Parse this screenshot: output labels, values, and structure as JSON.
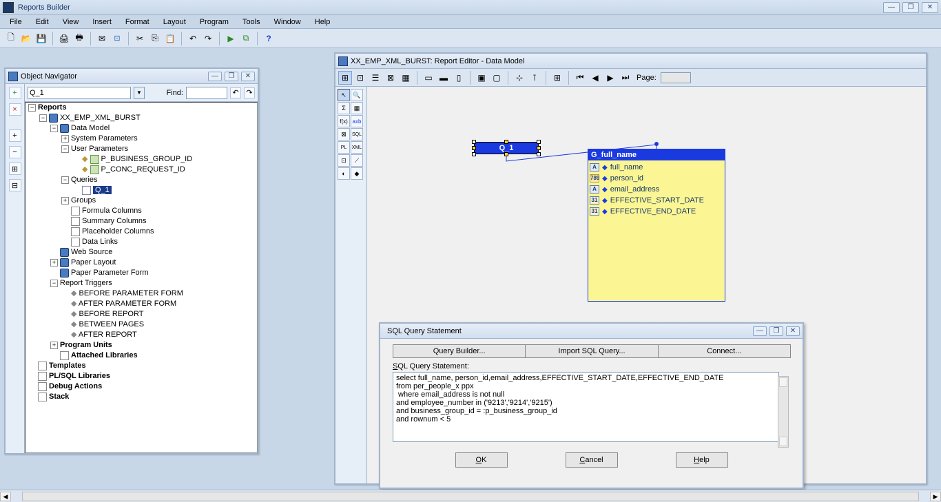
{
  "app": {
    "title": "Reports Builder"
  },
  "menus": [
    "File",
    "Edit",
    "View",
    "Insert",
    "Format",
    "Layout",
    "Program",
    "Tools",
    "Window",
    "Help"
  ],
  "objnav": {
    "title": "Object Navigator",
    "current": "Q_1",
    "find_label": "Find:",
    "find_value": "",
    "tree": {
      "root": "Reports",
      "report": "XX_EMP_XML_BURST",
      "data_model": "Data Model",
      "sys_params": "System Parameters",
      "user_params": "User Parameters",
      "p_bgid": "P_BUSINESS_GROUP_ID",
      "p_conc": "P_CONC_REQUEST_ID",
      "queries": "Queries",
      "q1": "Q_1",
      "groups": "Groups",
      "formula": "Formula Columns",
      "summary": "Summary Columns",
      "placeholder": "Placeholder Columns",
      "datalinks": "Data Links",
      "websource": "Web Source",
      "paper_layout": "Paper Layout",
      "paper_param": "Paper Parameter Form",
      "rep_triggers": "Report Triggers",
      "t_before_pf": "BEFORE PARAMETER FORM",
      "t_after_pf": "AFTER PARAMETER FORM",
      "t_before_rep": "BEFORE REPORT",
      "t_between": "BETWEEN PAGES",
      "t_after_rep": "AFTER REPORT",
      "prog_units": "Program Units",
      "att_lib": "Attached Libraries",
      "templates": "Templates",
      "plsql_lib": "PL/SQL Libraries",
      "debug": "Debug Actions",
      "stack": "Stack"
    }
  },
  "editor": {
    "title": "XX_EMP_XML_BURST: Report Editor - Data Model",
    "page_label": "Page:",
    "page_value": "",
    "q_label": "Q_1",
    "group": {
      "name": "G_full_name",
      "cols": [
        {
          "label": "full_name",
          "type": "A"
        },
        {
          "label": "person_id",
          "type": "789"
        },
        {
          "label": "email_address",
          "type": "A"
        },
        {
          "label": "EFFECTIVE_START_DATE",
          "type": "31"
        },
        {
          "label": "EFFECTIVE_END_DATE",
          "type": "31"
        }
      ]
    }
  },
  "sql": {
    "title": "SQL Query Statement",
    "tab_qb": "Query Builder...",
    "tab_import": "Import SQL Query...",
    "tab_connect": "Connect...",
    "label": "SQL Query Statement:",
    "text": "select full_name, person_id,email_address,EFFECTIVE_START_DATE,EFFECTIVE_END_DATE\nfrom per_people_x ppx\n where email_address is not null\nand employee_number in ('9213','9214','9215')\nand business_group_id = :p_business_group_id\nand rownum < 5",
    "btn_ok": "OK",
    "btn_cancel": "Cancel",
    "btn_help": "Help"
  }
}
